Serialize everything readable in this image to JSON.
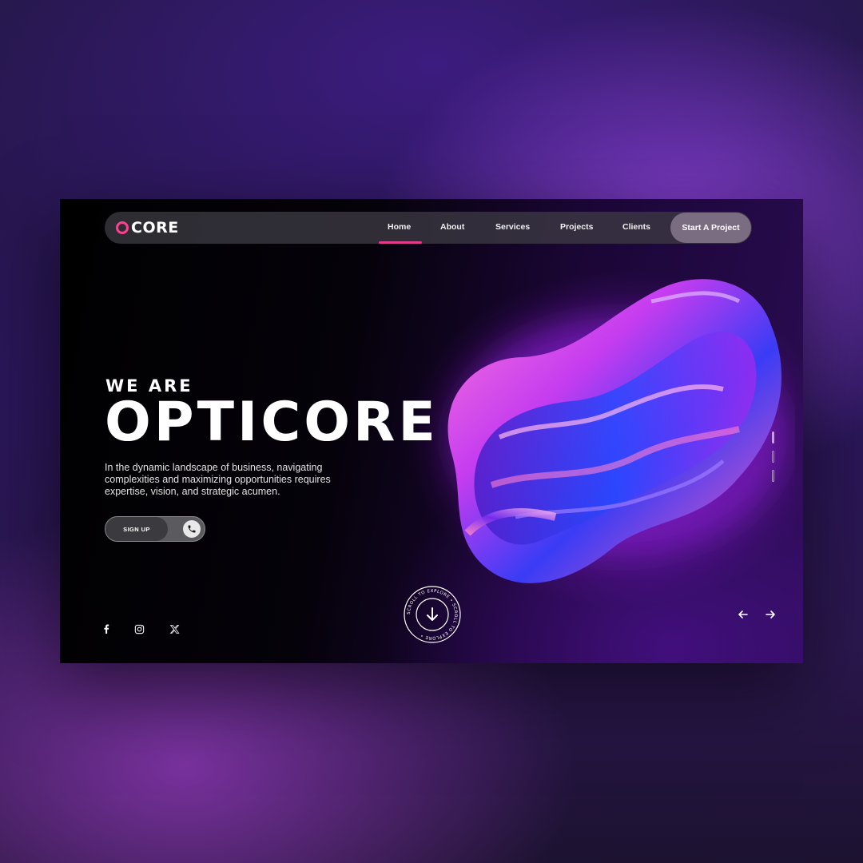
{
  "brand": {
    "logo_text": "CORE",
    "accent": "#ff3f92"
  },
  "nav": {
    "items": [
      {
        "label": "Home",
        "active": true
      },
      {
        "label": "About"
      },
      {
        "label": "Services"
      },
      {
        "label": "Projects"
      },
      {
        "label": "Clients"
      }
    ],
    "cta": "Start A Project"
  },
  "hero": {
    "eyebrow": "WE ARE",
    "title": "OPTICORE",
    "description": "In the dynamic landscape of business, navigating complexities and maximizing opportunities requires expertise, vision, and strategic acumen.",
    "signup_label": "SIGN UP"
  },
  "scroll_badge": {
    "ring_text": "SCROLL TO EXPLORE • SCROLL TO EXPLORE • "
  },
  "slide_indicator": {
    "count": 3,
    "active_index": 0
  },
  "social": [
    "facebook-icon",
    "instagram-icon",
    "x-icon"
  ],
  "colors": {
    "nav_bg": "#3c3a42",
    "cta_bg": "#7a6d82",
    "underline": "#e33a8d"
  }
}
